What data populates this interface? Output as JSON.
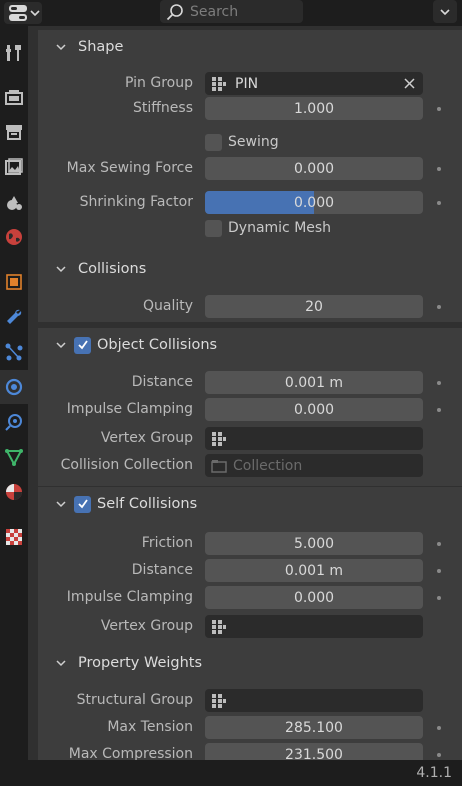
{
  "header": {
    "search_placeholder": "Search"
  },
  "sections": {
    "shape": {
      "title": "Shape",
      "pin_group_label": "Pin Group",
      "pin_group_value": "PIN",
      "stiffness_label": "Stiffness",
      "stiffness_value": "1.000",
      "sewing_label": "Sewing",
      "max_sewing_force_label": "Max Sewing Force",
      "max_sewing_force_value": "0.000",
      "shrinking_factor_label": "Shrinking Factor",
      "shrinking_factor_value": "0.000",
      "shrinking_factor_fill": 0.5,
      "dynamic_mesh_label": "Dynamic Mesh"
    },
    "collisions": {
      "title": "Collisions",
      "quality_label": "Quality",
      "quality_value": "20"
    },
    "object_collisions": {
      "title": "Object Collisions",
      "distance_label": "Distance",
      "distance_value": "0.001 m",
      "impulse_label": "Impulse Clamping",
      "impulse_value": "0.000",
      "vertex_group_label": "Vertex Group",
      "collection_label": "Collision Collection",
      "collection_placeholder": "Collection"
    },
    "self_collisions": {
      "title": "Self Collisions",
      "friction_label": "Friction",
      "friction_value": "5.000",
      "distance_label": "Distance",
      "distance_value": "0.001 m",
      "impulse_label": "Impulse Clamping",
      "impulse_value": "0.000",
      "vertex_group_label": "Vertex Group"
    },
    "property_weights": {
      "title": "Property Weights",
      "structural_group_label": "Structural Group",
      "max_tension_label": "Max Tension",
      "max_tension_value": "285.100",
      "max_compression_label": "Max Compression",
      "max_compression_value": "231.500"
    }
  },
  "status": {
    "version": "4.1.1"
  },
  "colors": {
    "accent": "#4772b3",
    "panel": "#303030",
    "section": "#3d3d3d",
    "field": "#545454"
  }
}
